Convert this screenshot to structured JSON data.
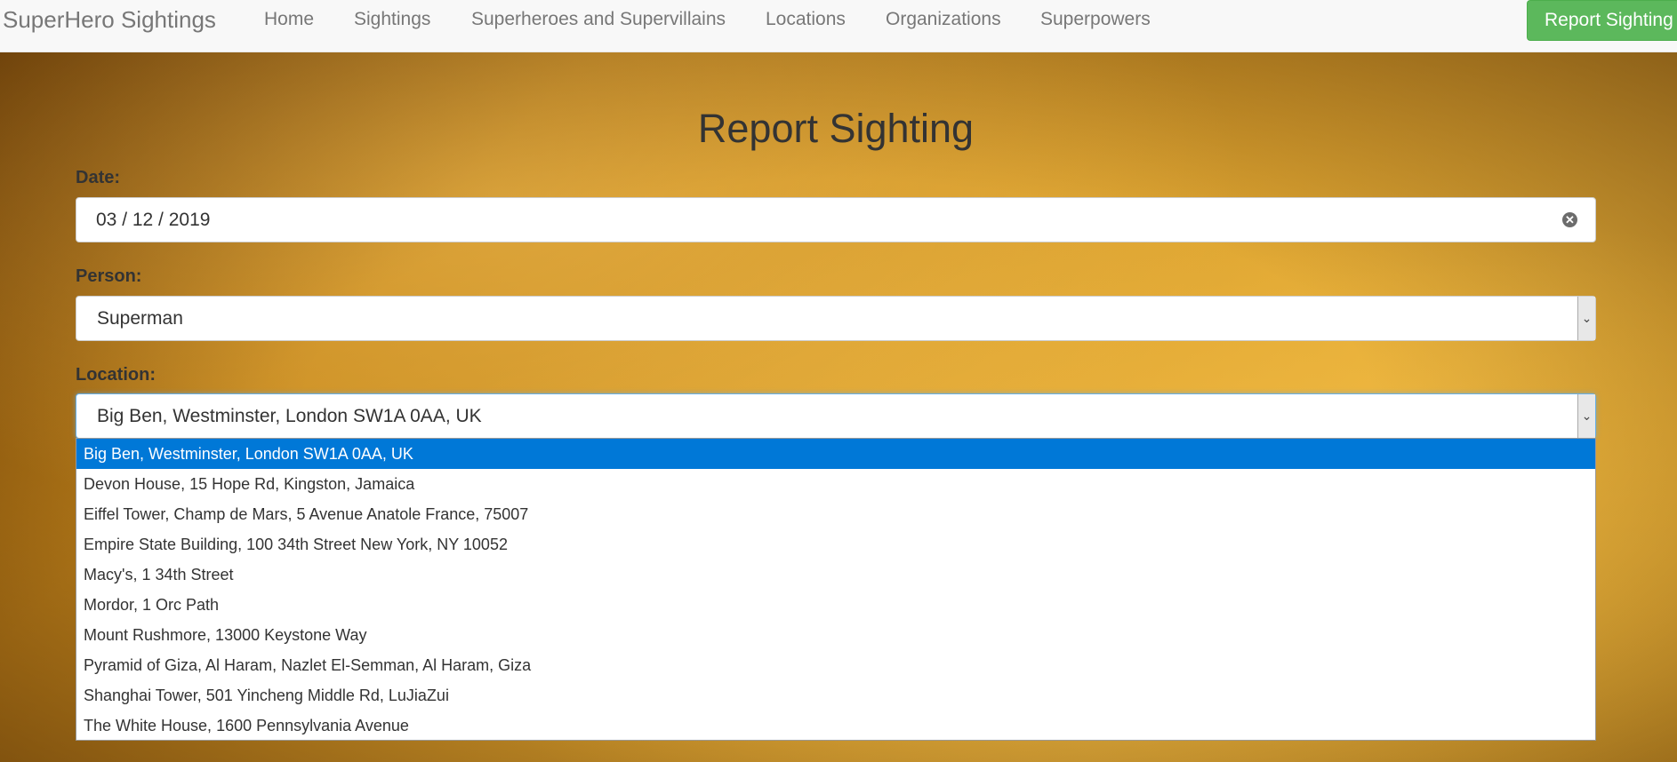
{
  "navbar": {
    "brand": "SuperHero Sightings",
    "links": [
      "Home",
      "Sightings",
      "Superheroes and Supervillains",
      "Locations",
      "Organizations",
      "Superpowers"
    ],
    "report_button": "Report Sighting"
  },
  "form": {
    "title": "Report Sighting",
    "date_label": "Date:",
    "date_value": "03 / 12 / 2019",
    "person_label": "Person:",
    "person_value": "Superman",
    "location_label": "Location:",
    "location_value": "Big Ben, Westminster, London SW1A 0AA, UK",
    "location_options": [
      "Big Ben, Westminster, London SW1A 0AA, UK",
      "Devon House, 15 Hope Rd, Kingston, Jamaica",
      "Eiffel Tower, Champ de Mars, 5 Avenue Anatole France, 75007",
      "Empire State Building, 100 34th Street New York, NY 10052",
      "Macy's, 1 34th Street",
      "Mordor, 1 Orc Path",
      "Mount Rushmore, 13000 Keystone Way",
      "Pyramid of Giza, Al Haram, Nazlet El-Semman, Al Haram, Giza",
      "Shanghai Tower, 501 Yincheng Middle Rd, LuJiaZui",
      "The White House, 1600 Pennsylvania Avenue"
    ],
    "selected_option_index": 0
  },
  "icons": {
    "clear": "clear-icon",
    "dropdown": "chevron-down-icon"
  },
  "colors": {
    "navbar_bg": "#f8f8f8",
    "report_button": "#5cb85c",
    "selected_option": "#0078d7"
  }
}
